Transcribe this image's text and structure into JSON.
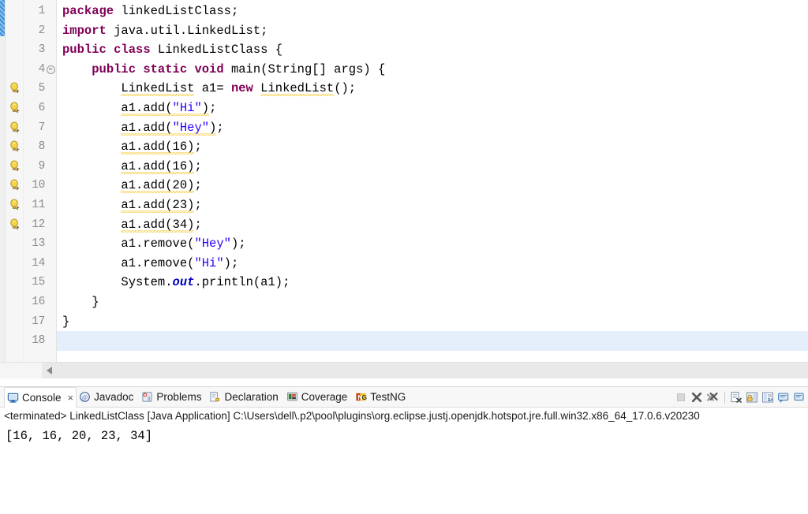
{
  "editor": {
    "first_line_number": 1,
    "current_line": 18,
    "lines": [
      {
        "n": 1,
        "warning": false,
        "fold": false,
        "current": false,
        "tokens": [
          {
            "t": "package",
            "c": "kw"
          },
          {
            "t": " linkedListClass;",
            "c": "plain"
          }
        ]
      },
      {
        "n": 2,
        "warning": false,
        "fold": false,
        "current": false,
        "tokens": [
          {
            "t": "import",
            "c": "kw"
          },
          {
            "t": " java.util.LinkedList;",
            "c": "plain"
          }
        ]
      },
      {
        "n": 3,
        "warning": false,
        "fold": false,
        "current": false,
        "tokens": [
          {
            "t": "public class",
            "c": "kw"
          },
          {
            "t": " LinkedListClass {",
            "c": "plain"
          }
        ]
      },
      {
        "n": 4,
        "warning": false,
        "fold": true,
        "current": false,
        "tokens": [
          {
            "t": "    ",
            "c": "plain"
          },
          {
            "t": "public static void",
            "c": "kw"
          },
          {
            "t": " main(String[] args) {",
            "c": "plain"
          }
        ]
      },
      {
        "n": 5,
        "warning": true,
        "fold": false,
        "current": false,
        "tokens": [
          {
            "t": "        ",
            "c": "plain"
          },
          {
            "t": "LinkedList",
            "c": "warn"
          },
          {
            "t": " a1= ",
            "c": "plain"
          },
          {
            "t": "new",
            "c": "kw"
          },
          {
            "t": " ",
            "c": "plain"
          },
          {
            "t": "LinkedList",
            "c": "warn"
          },
          {
            "t": "();",
            "c": "plain"
          }
        ]
      },
      {
        "n": 6,
        "warning": true,
        "fold": false,
        "current": false,
        "tokens": [
          {
            "t": "        ",
            "c": "plain"
          },
          {
            "t": "a1.add(",
            "c": "warn"
          },
          {
            "t": "\"Hi\"",
            "c": "str-warn"
          },
          {
            "t": ")",
            "c": "warn"
          },
          {
            "t": ";",
            "c": "plain"
          }
        ]
      },
      {
        "n": 7,
        "warning": true,
        "fold": false,
        "current": false,
        "tokens": [
          {
            "t": "        ",
            "c": "plain"
          },
          {
            "t": "a1.add(",
            "c": "warn"
          },
          {
            "t": "\"Hey\"",
            "c": "str-warn"
          },
          {
            "t": ")",
            "c": "warn"
          },
          {
            "t": ";",
            "c": "plain"
          }
        ]
      },
      {
        "n": 8,
        "warning": true,
        "fold": false,
        "current": false,
        "tokens": [
          {
            "t": "        ",
            "c": "plain"
          },
          {
            "t": "a1.add(16)",
            "c": "warn"
          },
          {
            "t": ";",
            "c": "plain"
          }
        ]
      },
      {
        "n": 9,
        "warning": true,
        "fold": false,
        "current": false,
        "tokens": [
          {
            "t": "        ",
            "c": "plain"
          },
          {
            "t": "a1.add(16)",
            "c": "warn"
          },
          {
            "t": ";",
            "c": "plain"
          }
        ]
      },
      {
        "n": 10,
        "warning": true,
        "fold": false,
        "current": false,
        "tokens": [
          {
            "t": "        ",
            "c": "plain"
          },
          {
            "t": "a1.add(20)",
            "c": "warn"
          },
          {
            "t": ";",
            "c": "plain"
          }
        ]
      },
      {
        "n": 11,
        "warning": true,
        "fold": false,
        "current": false,
        "tokens": [
          {
            "t": "        ",
            "c": "plain"
          },
          {
            "t": "a1.add(23)",
            "c": "warn"
          },
          {
            "t": ";",
            "c": "plain"
          }
        ]
      },
      {
        "n": 12,
        "warning": true,
        "fold": false,
        "current": false,
        "tokens": [
          {
            "t": "        ",
            "c": "plain"
          },
          {
            "t": "a1.add(34)",
            "c": "warn"
          },
          {
            "t": ";",
            "c": "plain"
          }
        ]
      },
      {
        "n": 13,
        "warning": false,
        "fold": false,
        "current": false,
        "tokens": [
          {
            "t": "        ",
            "c": "plain"
          },
          {
            "t": "a1.remove(",
            "c": "plain"
          },
          {
            "t": "\"Hey\"",
            "c": "str"
          },
          {
            "t": ");",
            "c": "plain"
          }
        ]
      },
      {
        "n": 14,
        "warning": false,
        "fold": false,
        "current": false,
        "tokens": [
          {
            "t": "        ",
            "c": "plain"
          },
          {
            "t": "a1.remove(",
            "c": "plain"
          },
          {
            "t": "\"Hi\"",
            "c": "str"
          },
          {
            "t": ");",
            "c": "plain"
          }
        ]
      },
      {
        "n": 15,
        "warning": false,
        "fold": false,
        "current": false,
        "tokens": [
          {
            "t": "        ",
            "c": "plain"
          },
          {
            "t": "System.",
            "c": "plain"
          },
          {
            "t": "out",
            "c": "fld"
          },
          {
            "t": ".println(a1);",
            "c": "plain"
          }
        ]
      },
      {
        "n": 16,
        "warning": false,
        "fold": false,
        "current": false,
        "tokens": [
          {
            "t": "    }",
            "c": "plain"
          }
        ]
      },
      {
        "n": 17,
        "warning": false,
        "fold": false,
        "current": false,
        "tokens": [
          {
            "t": "}",
            "c": "plain"
          }
        ]
      },
      {
        "n": 18,
        "warning": false,
        "fold": false,
        "current": true,
        "tokens": [
          {
            "t": "",
            "c": "plain"
          }
        ]
      }
    ]
  },
  "panel": {
    "tabs": [
      {
        "label": "Console",
        "icon": "console-icon",
        "active": true,
        "closable": true,
        "close_label": "×"
      },
      {
        "label": "Javadoc",
        "icon": "javadoc-icon",
        "active": false,
        "closable": false,
        "close_label": ""
      },
      {
        "label": "Problems",
        "icon": "problems-icon",
        "active": false,
        "closable": false,
        "close_label": ""
      },
      {
        "label": "Declaration",
        "icon": "declaration-icon",
        "active": false,
        "closable": false,
        "close_label": ""
      },
      {
        "label": "Coverage",
        "icon": "coverage-icon",
        "active": false,
        "closable": false,
        "close_label": ""
      },
      {
        "label": "TestNG",
        "icon": "testng-icon",
        "active": false,
        "closable": false,
        "close_label": ""
      }
    ],
    "toolbar": [
      {
        "name": "terminate-button",
        "enabled": false
      },
      {
        "name": "remove-launch-button",
        "enabled": true
      },
      {
        "name": "remove-all-terminated-button",
        "enabled": true
      },
      {
        "name": "separator",
        "enabled": false
      },
      {
        "name": "clear-console-button",
        "enabled": true
      },
      {
        "name": "scroll-lock-button",
        "enabled": true
      },
      {
        "name": "word-wrap-button",
        "enabled": true
      },
      {
        "name": "show-console-button",
        "enabled": true
      },
      {
        "name": "pin-console-button",
        "enabled": true
      }
    ],
    "terminated_line": "<terminated> LinkedListClass [Java Application] C:\\Users\\dell\\.p2\\pool\\plugins\\org.eclipse.justj.openjdk.hotspot.jre.full.win32.x86_64_17.0.6.v20230",
    "console_output": "[16, 16, 20, 23, 34]"
  },
  "colors": {
    "keyword": "#7F0055",
    "string": "#2A00FF",
    "field": "#0000C0",
    "current_line": "#E4EFFB",
    "warning_squiggle": "#F5CF4A",
    "gutter_bg": "#F6F6F6",
    "line_number": "#8C8C8C",
    "change_marker": "#3F8FD2"
  }
}
